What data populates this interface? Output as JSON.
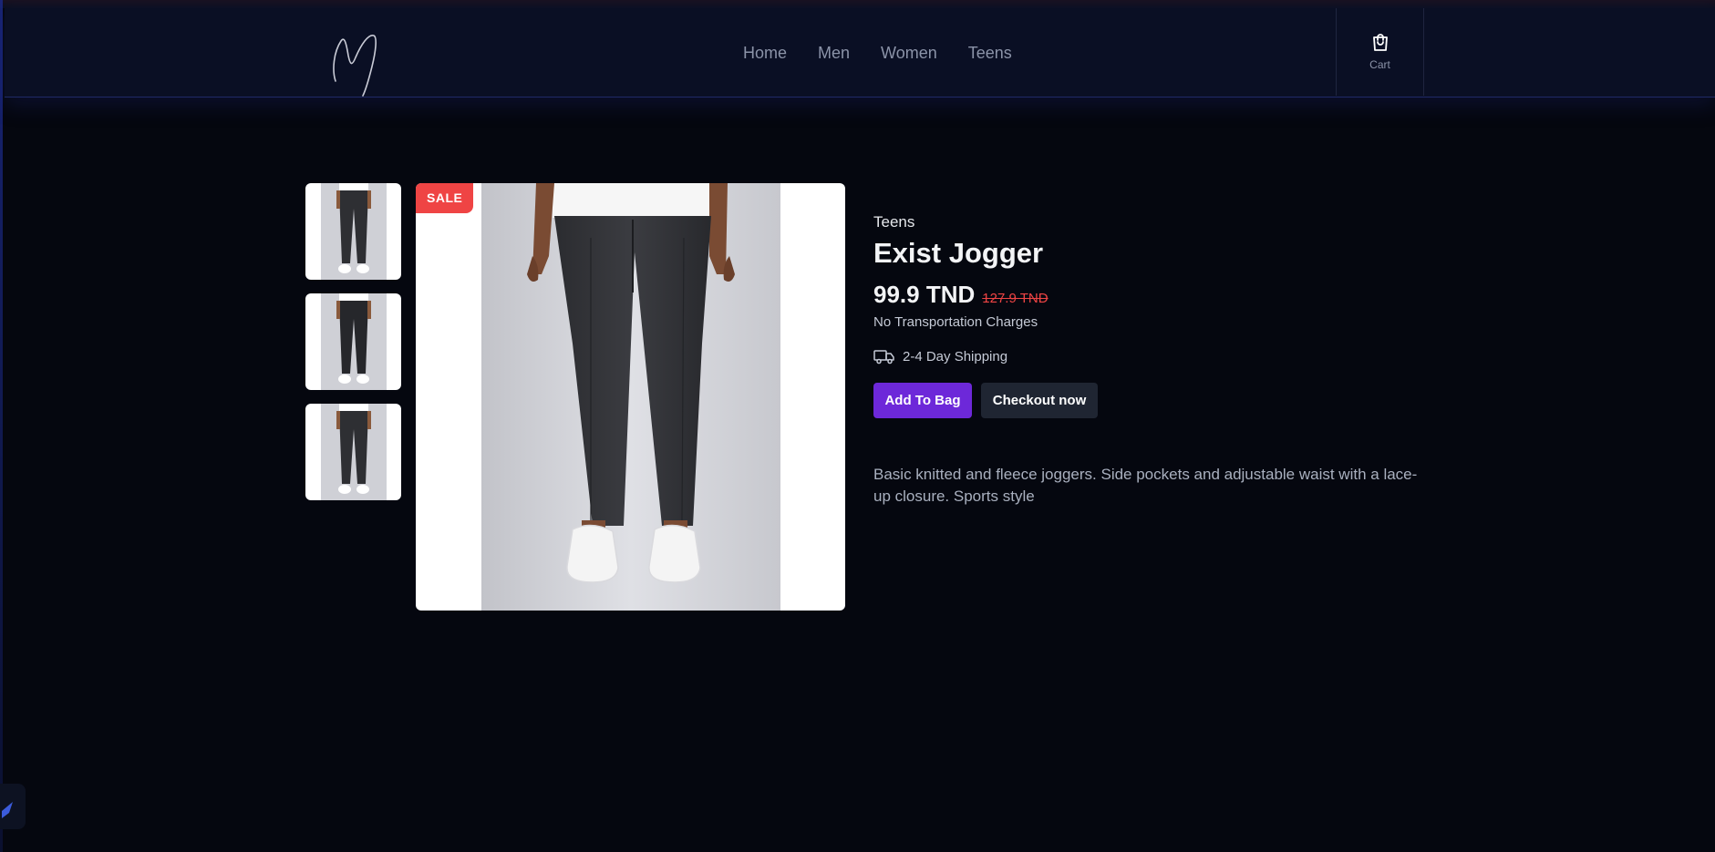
{
  "header": {
    "nav": [
      "Home",
      "Men",
      "Women",
      "Teens"
    ],
    "cart_label": "Cart"
  },
  "gallery": {
    "sale_badge": "SALE",
    "thumbnail_count": 3
  },
  "product": {
    "category": "Teens",
    "name": "Exist Jogger",
    "price": "99.9 TND",
    "old_price": "127.9 TND",
    "transport_note": "No Transportation Charges",
    "shipping": "2-4 Day Shipping",
    "add_to_bag": "Add To Bag",
    "checkout": "Checkout now",
    "description": "Basic knitted and fleece joggers. Side pockets and adjustable waist with a lace-up closure. Sports style"
  },
  "colors": {
    "background": "#05070f",
    "header": "#0a0f24",
    "primary_button": "#6d28d9",
    "secondary_button": "#1f2532",
    "sale_badge": "#ef4444",
    "old_price": "#ef4444"
  },
  "icons": [
    "signature-logo",
    "shopping-bag-icon",
    "truck-icon",
    "jogger-photo"
  ]
}
